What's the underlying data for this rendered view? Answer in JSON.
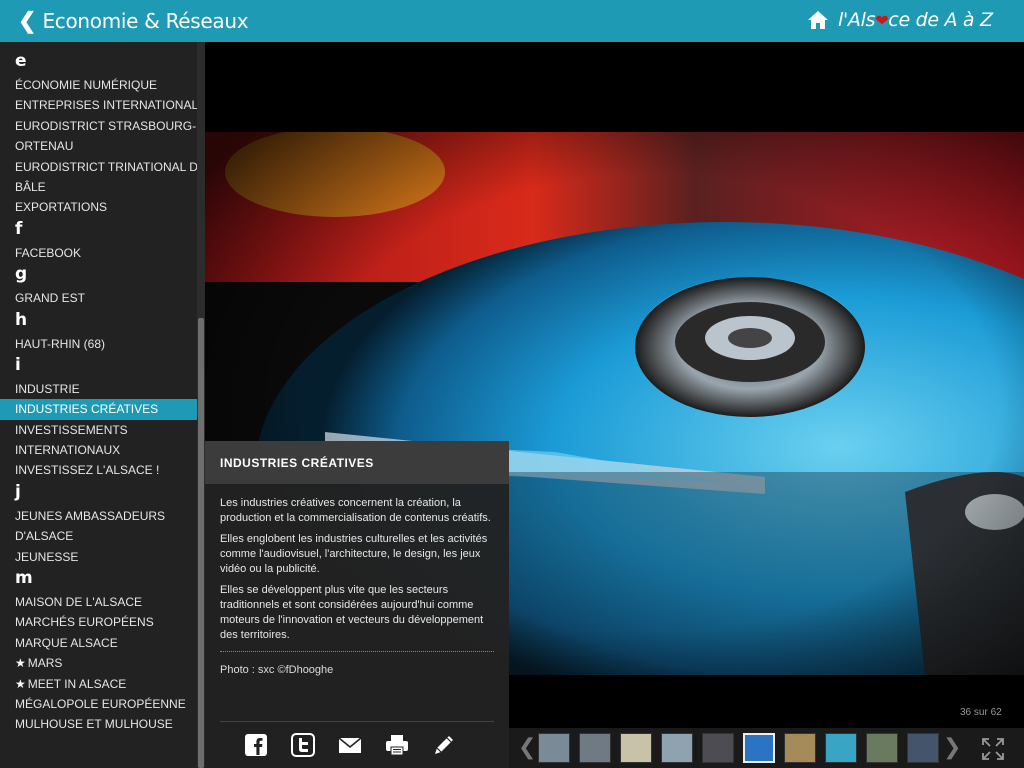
{
  "header": {
    "back_label": "Economie & Réseaux",
    "brand_prefix": "l'Als",
    "brand_heart": "❤",
    "brand_suffix": "ce de A à Z"
  },
  "sidebar": {
    "sections": [
      {
        "letter": "e",
        "items": [
          {
            "label": "ÉCONOMIE NUMÉRIQUE"
          },
          {
            "label": "ENTREPRISES INTERNATIONALES"
          },
          {
            "label": "EURODISTRICT STRASBOURG-"
          },
          {
            "label": "ORTENAU"
          },
          {
            "label": "EURODISTRICT TRINATIONAL DE"
          },
          {
            "label": "BÂLE"
          },
          {
            "label": "EXPORTATIONS"
          }
        ]
      },
      {
        "letter": "f",
        "items": [
          {
            "label": "FACEBOOK"
          }
        ]
      },
      {
        "letter": "g",
        "items": [
          {
            "label": "GRAND EST"
          }
        ]
      },
      {
        "letter": "h",
        "items": [
          {
            "label": "HAUT-RHIN (68)"
          }
        ]
      },
      {
        "letter": "i",
        "items": [
          {
            "label": "INDUSTRIE"
          },
          {
            "label": "INDUSTRIES CRÉATIVES",
            "active": true
          },
          {
            "label": "INVESTISSEMENTS"
          },
          {
            "label": "INTERNATIONAUX"
          },
          {
            "label": "INVESTISSEZ L'ALSACE !"
          }
        ]
      },
      {
        "letter": "j",
        "items": [
          {
            "label": "JEUNES AMBASSADEURS"
          },
          {
            "label": "D'ALSACE"
          },
          {
            "label": "JEUNESSE"
          }
        ]
      },
      {
        "letter": "m",
        "items": [
          {
            "label": "MAISON DE L'ALSACE"
          },
          {
            "label": "MARCHÉS EUROPÉENS"
          },
          {
            "label": "MARQUE ALSACE"
          },
          {
            "label": "MARS",
            "starred": true
          },
          {
            "label": "MEET IN ALSACE",
            "starred": true
          },
          {
            "label": "MÉGALOPOLE EUROPÉENNE"
          },
          {
            "label": "MULHOUSE ET MULHOUSE"
          }
        ]
      }
    ]
  },
  "panel": {
    "title": "INDUSTRIES CRÉATIVES",
    "paragraphs": [
      "Les industries créatives concernent la création, la production et la commercialisation de contenus créatifs.",
      "Elles englobent les industries culturelles et les activités comme l'audiovisuel, l'architecture, le design, les jeux vidéo ou la publicité.",
      "Elles se développent plus vite que les secteurs traditionnels et sont considérées aujourd'hui comme moteurs de l'innovation et vecteurs du développement des territoires."
    ],
    "credit": "Photo : sxc ©fDhooghe",
    "share_icons": [
      "facebook-icon",
      "twitter-icon",
      "email-icon",
      "print-icon",
      "edit-icon"
    ]
  },
  "gallery": {
    "counter": "36 sur 62",
    "thumbs": [
      {
        "color": "#7a8a96",
        "active": false
      },
      {
        "color": "#6f7a85",
        "active": false
      },
      {
        "color": "#c8c2a8",
        "active": false
      },
      {
        "color": "#8fa2b0",
        "active": false
      },
      {
        "color": "#4c4c52",
        "active": false
      },
      {
        "color": "#2b74c4",
        "active": true
      },
      {
        "color": "#a58a5a",
        "active": false
      },
      {
        "color": "#3aa4c4",
        "active": false
      },
      {
        "color": "#6a7a5e",
        "active": false
      },
      {
        "color": "#44546a",
        "active": false
      }
    ]
  },
  "colors": {
    "accent": "#1f9ab5",
    "sidebar_bg": "#222222",
    "panel_title_bg": "#3c3c3c"
  }
}
